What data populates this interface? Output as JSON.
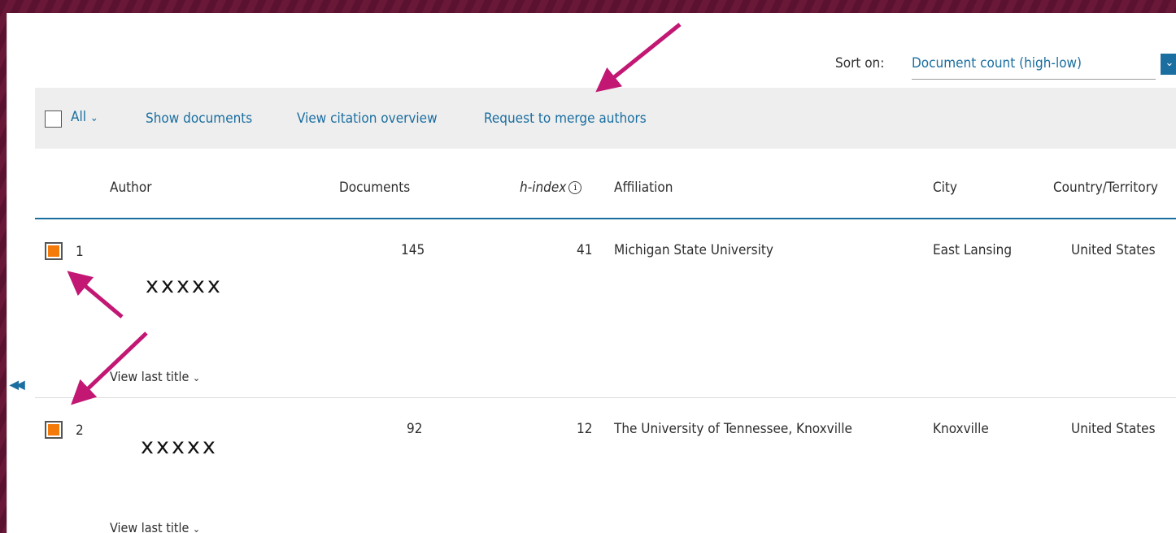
{
  "sort": {
    "label": "Sort on:",
    "value": "Document count (high-low)"
  },
  "toolbar": {
    "all_label": "All",
    "show_documents": "Show documents",
    "view_citation_overview": "View citation overview",
    "request_merge": "Request to merge authors"
  },
  "table": {
    "headers": {
      "author": "Author",
      "documents": "Documents",
      "h_index": "h-index",
      "affiliation": "Affiliation",
      "city": "City",
      "country": "Country/Territory"
    },
    "rows": [
      {
        "index": "1",
        "author": "xxxxx",
        "documents": "145",
        "h_index": "41",
        "affiliation": "Michigan State University",
        "city": "East Lansing",
        "country": "United States",
        "view_last_title": "View last title",
        "checked": true
      },
      {
        "index": "2",
        "author": "xxxxx",
        "documents": "92",
        "h_index": "12",
        "affiliation": "The University of Tennessee, Knoxville",
        "city": "Knoxville",
        "country": "United States",
        "view_last_title": "View last title",
        "checked": true
      }
    ]
  },
  "colors": {
    "accent": "#1a6ea0",
    "checkbox_fill": "#f47a0a",
    "annotation_arrow": "#c21874",
    "background": "#5b1230"
  },
  "icons": {
    "collapse": "double-chevron-left-icon",
    "info": "info-icon",
    "sort_caret": "chevron-down-icon"
  }
}
